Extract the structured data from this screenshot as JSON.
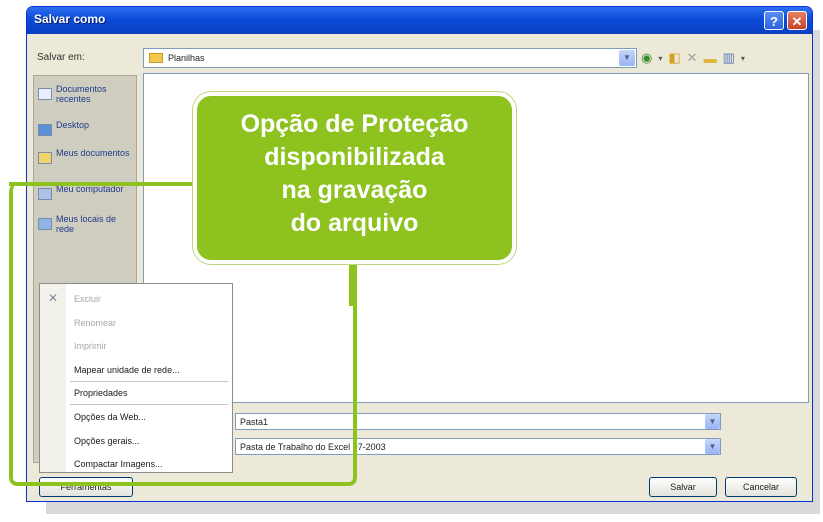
{
  "window": {
    "title": "Salvar como",
    "help_label": "?",
    "close_label": "✕"
  },
  "save_in": {
    "label": "Salvar em:",
    "folder": "Planilhas"
  },
  "places": [
    {
      "label": "Documentos recentes",
      "icon": "recent-documents-icon"
    },
    {
      "label": "Desktop",
      "icon": "desktop-icon"
    },
    {
      "label": "Meus documentos",
      "icon": "my-documents-icon"
    },
    {
      "label": "Meu computador",
      "icon": "my-computer-icon"
    },
    {
      "label": "Meus locais de rede",
      "icon": "network-places-icon"
    }
  ],
  "callout": {
    "line1": "Opção de Proteção",
    "line2": "disponibilizada",
    "line3": "na gravação",
    "line4": "do arquivo"
  },
  "menu": {
    "items": [
      {
        "label": "Excluir",
        "disabled": true
      },
      {
        "label": "Renomear",
        "disabled": true
      },
      {
        "label": "Imprimir",
        "disabled": true
      },
      {
        "label": "Mapear unidade de rede...",
        "disabled": false
      },
      {
        "label": "Propriedades",
        "disabled": false
      },
      {
        "label": "Opções da Web...",
        "disabled": false
      },
      {
        "label": "Opções gerais...",
        "disabled": false
      },
      {
        "label": "Compactar Imagens...",
        "disabled": false
      }
    ]
  },
  "file_name": {
    "value": "Pasta1"
  },
  "file_type": {
    "value": "Pasta de Trabalho do Excel 97-2003"
  },
  "buttons": {
    "tools": "Ferramentas",
    "save": "Salvar",
    "cancel": "Cancelar"
  },
  "colors": {
    "accent_green": "#8dc21f",
    "titlebar_blue": "#0b4bd8"
  }
}
